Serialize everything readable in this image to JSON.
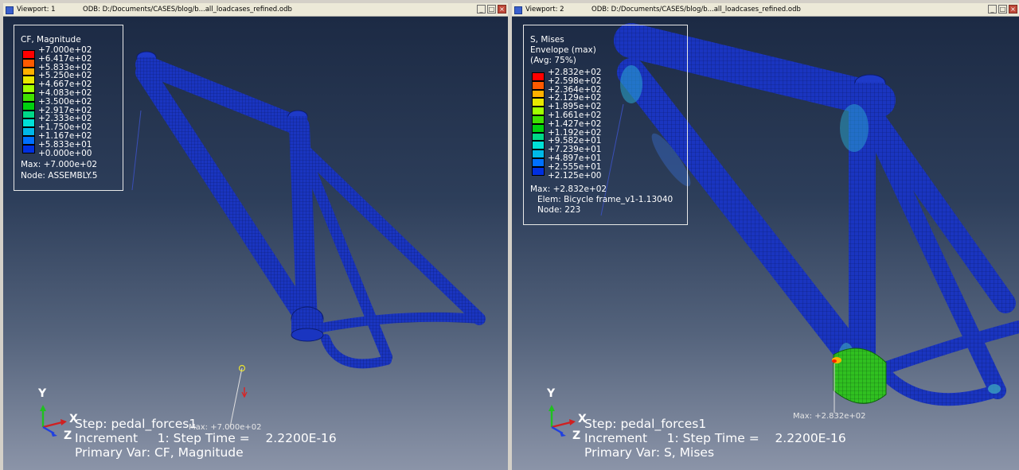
{
  "viewport1": {
    "title": "Viewport: 1",
    "odb": "ODB: D:/Documents/CASES/blog/b...all_loadcases_refined.odb",
    "legend": {
      "title": "CF, Magnitude",
      "values": [
        "+7.000e+02",
        "+6.417e+02",
        "+5.833e+02",
        "+5.250e+02",
        "+4.667e+02",
        "+4.083e+02",
        "+3.500e+02",
        "+2.917e+02",
        "+2.333e+02",
        "+1.750e+02",
        "+1.167e+02",
        "+5.833e+01",
        "+0.000e+00"
      ],
      "max": "Max: +7.000e+02",
      "node": "Node: ASSEMBLY.5"
    },
    "max_marker": "Max: +7.000e+02",
    "step": "Step: pedal_forces1",
    "increment": "Increment     1: Step Time =    2.2200E-16",
    "primary_var": "Primary Var: CF, Magnitude"
  },
  "viewport2": {
    "title": "Viewport: 2",
    "odb": "ODB: D:/Documents/CASES/blog/b...all_loadcases_refined.odb",
    "legend": {
      "title": "S, Mises",
      "subtitle1": "Envelope (max)",
      "subtitle2": "(Avg: 75%)",
      "values": [
        "+2.832e+02",
        "+2.598e+02",
        "+2.364e+02",
        "+2.129e+02",
        "+1.895e+02",
        "+1.661e+02",
        "+1.427e+02",
        "+1.192e+02",
        "+9.582e+01",
        "+7.239e+01",
        "+4.897e+01",
        "+2.555e+01",
        "+2.125e+00"
      ],
      "max": "Max: +2.832e+02",
      "elem": "Elem: Bicycle frame_v1-1.13040",
      "node": "Node: 223"
    },
    "max_marker": "Max: +2.832e+02",
    "step": "Step: pedal_forces1",
    "increment": "Increment     1: Step Time =    2.2200E-16",
    "primary_var": "Primary Var: S, Mises"
  },
  "triad": {
    "x": "X",
    "y": "Y",
    "z": "Z"
  },
  "window_buttons": {
    "minimize": "_",
    "restore": "□",
    "close": "×"
  },
  "colors": {
    "legend_scale": [
      "#ff0000",
      "#ff5a00",
      "#ffb000",
      "#e8e800",
      "#a0ff00",
      "#40e000",
      "#00d010",
      "#00d888",
      "#00e0d8",
      "#00b8e8",
      "#0070ff",
      "#0030e0",
      "#0000c8"
    ],
    "mesh_blue": "#1530b8",
    "background_top": "#1c2a44",
    "background_bottom": "#8b94a8"
  }
}
